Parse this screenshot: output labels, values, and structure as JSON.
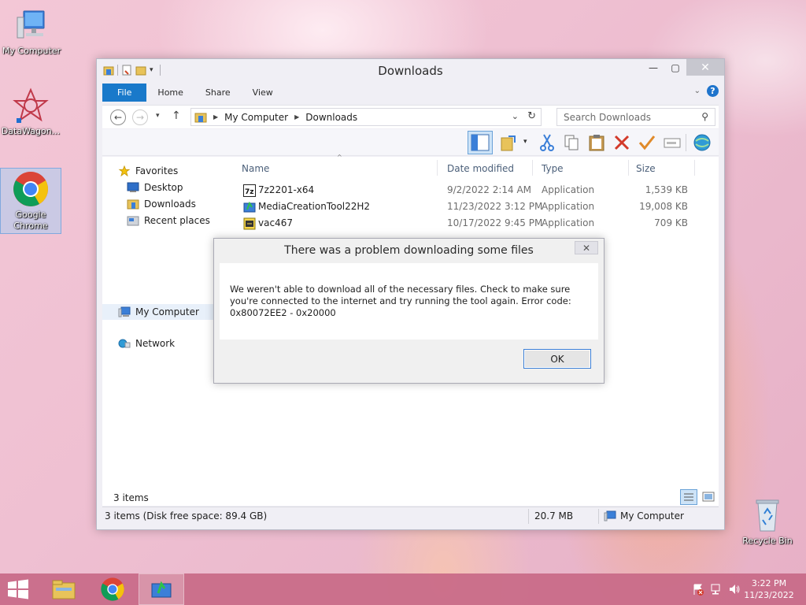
{
  "desktop": {
    "icons": [
      {
        "label": "My Computer"
      },
      {
        "label": "DataWagon..."
      },
      {
        "label": "Google Chrome"
      },
      {
        "label": "Recycle Bin"
      }
    ]
  },
  "window": {
    "title": "Downloads",
    "ribbon_tabs": [
      "File",
      "Home",
      "Share",
      "View"
    ],
    "address": {
      "root": "My Computer",
      "current": "Downloads"
    },
    "search_placeholder": "Search Downloads",
    "nav": {
      "favorites": "Favorites",
      "desktop": "Desktop",
      "downloads": "Downloads",
      "recent": "Recent places",
      "computer": "My Computer",
      "network": "Network"
    },
    "columns": {
      "name": "Name",
      "date": "Date modified",
      "type": "Type",
      "size": "Size"
    },
    "files": [
      {
        "name": "7z2201-x64",
        "date": "9/2/2022 2:14 AM",
        "type": "Application",
        "size": "1,539 KB"
      },
      {
        "name": "MediaCreationTool22H2",
        "date": "11/23/2022 3:12 PM",
        "type": "Application",
        "size": "19,008 KB"
      },
      {
        "name": "vac467",
        "date": "10/17/2022 9:45 PM",
        "type": "Application",
        "size": "709 KB"
      }
    ],
    "item_count": "3 items",
    "status": {
      "summary": "3 items (Disk free space: 89.4 GB)",
      "size": "20.7 MB",
      "location": "My Computer"
    }
  },
  "dialog": {
    "title": "There was a problem downloading some files",
    "message": "We weren't able to download all of the necessary files. Check to make sure you're connected to the internet and try running the tool again. Error code: 0x80072EE2 - 0x20000",
    "ok_label": "OK"
  },
  "taskbar": {
    "time": "3:22 PM",
    "date": "11/23/2022"
  },
  "colors": {
    "accent": "#1979ca",
    "taskbar": "#c8698a",
    "header_text": "#4c607a"
  }
}
